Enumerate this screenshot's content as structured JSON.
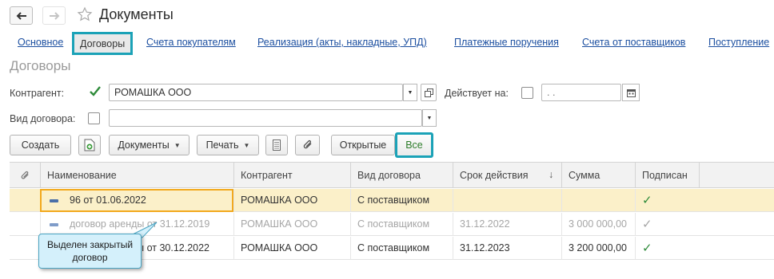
{
  "window": {
    "title": "Документы",
    "nav": {
      "back": "back-arrow-icon",
      "forward": "forward-arrow-icon",
      "favorite": "star-icon"
    }
  },
  "tabs": [
    {
      "label": "Основное",
      "active": false
    },
    {
      "label": "Договоры",
      "active": true
    },
    {
      "label": "Счета покупателям",
      "active": false
    },
    {
      "label": "Реализация (акты, накладные, УПД)",
      "active": false
    },
    {
      "label": "Платежные поручения",
      "active": false
    },
    {
      "label": "Счета от поставщиков",
      "active": false
    },
    {
      "label": "Поступление",
      "active": false
    }
  ],
  "section_title": "Договоры",
  "filters": {
    "counterparty_label": "Контрагент:",
    "counterparty_checked": true,
    "counterparty_value": "РОМАШКА ООО",
    "valid_on_label": "Действует на:",
    "valid_on_checked": false,
    "valid_on_value": "  .  .",
    "contract_type_label": "Вид договора:",
    "contract_type_checked": false,
    "contract_type_value": ""
  },
  "toolbar": {
    "create": "Создать",
    "documents": "Документы",
    "print": "Печать",
    "open": "Открытые",
    "all": "Все"
  },
  "table": {
    "columns": [
      "Наименование",
      "Контрагент",
      "Вид договора",
      "Срок действия",
      "Сумма",
      "Подписан"
    ],
    "sort_indicator": "↓",
    "rows": [
      {
        "name": "96 от 01.06.2022",
        "counterparty": "РОМАШКА ООО",
        "type": "С поставщиком",
        "term": "",
        "sum": "",
        "signed": "✓",
        "state": "selected"
      },
      {
        "name": "договор аренды от 31.12.2019",
        "counterparty": "РОМАШКА ООО",
        "type": "С поставщиком",
        "term": "31.12.2022",
        "sum": "3 000 000,00",
        "signed": "✓",
        "state": "closed"
      },
      {
        "name": "...ы от 30.12.2022",
        "counterparty": "РОМАШКА ООО",
        "type": "С поставщиком",
        "term": "31.12.2023",
        "sum": "3 200 000,00",
        "signed": "✓",
        "state": "normal"
      }
    ]
  },
  "callout": {
    "text_line1": "Выделен закрытый",
    "text_line2": "договор"
  },
  "colors": {
    "accent": "#1ba2b7",
    "link": "#1c4fa0",
    "selected_row": "#fbf0c9",
    "check": "#2e8b3a"
  }
}
